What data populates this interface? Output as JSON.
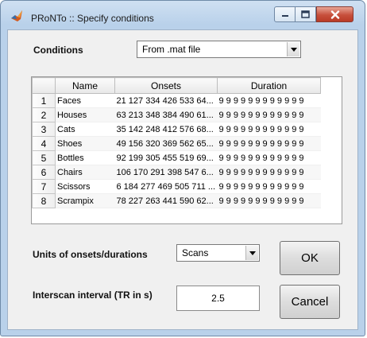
{
  "window": {
    "title": "PRoNTo :: Specify conditions"
  },
  "conditions": {
    "label": "Conditions",
    "selected": "From .mat file"
  },
  "table": {
    "columns": [
      "Name",
      "Onsets",
      "Duration"
    ],
    "rows": [
      {
        "num": "1",
        "name": "Faces",
        "onsets": "21 127 334 426 533 64...",
        "duration": "9 9 9 9 9 9 9 9 9 9 9 9"
      },
      {
        "num": "2",
        "name": "Houses",
        "onsets": "63 213 348 384 490 61...",
        "duration": "9 9 9 9 9 9 9 9 9 9 9 9"
      },
      {
        "num": "3",
        "name": "Cats",
        "onsets": "35 142 248 412 576 68...",
        "duration": "9 9 9 9 9 9 9 9 9 9 9 9"
      },
      {
        "num": "4",
        "name": "Shoes",
        "onsets": "49 156 320 369 562 65...",
        "duration": "9 9 9 9 9 9 9 9 9 9 9 9"
      },
      {
        "num": "5",
        "name": "Bottles",
        "onsets": "92 199 305 455 519 69...",
        "duration": "9 9 9 9 9 9 9 9 9 9 9 9"
      },
      {
        "num": "6",
        "name": "Chairs",
        "onsets": "106 170 291 398 547 6...",
        "duration": "9 9 9 9 9 9 9 9 9 9 9 9"
      },
      {
        "num": "7",
        "name": "Scissors",
        "onsets": "6 184 277 469 505 711 ...",
        "duration": "9 9 9 9 9 9 9 9 9 9 9 9"
      },
      {
        "num": "8",
        "name": "Scrampix",
        "onsets": "78 227 263 441 590 62...",
        "duration": "9 9 9 9 9 9 9 9 9 9 9 9"
      }
    ]
  },
  "units": {
    "label": "Units of onsets/durations",
    "selected": "Scans"
  },
  "interscan": {
    "label": "Interscan interval (TR in s)",
    "value": "2.5"
  },
  "buttons": {
    "ok": "OK",
    "cancel": "Cancel"
  },
  "icons": {
    "app": "matlab-icon",
    "minimize": "minimize-icon",
    "maximize": "maximize-icon",
    "close": "close-icon",
    "dropdown": "chevron-down-icon"
  }
}
